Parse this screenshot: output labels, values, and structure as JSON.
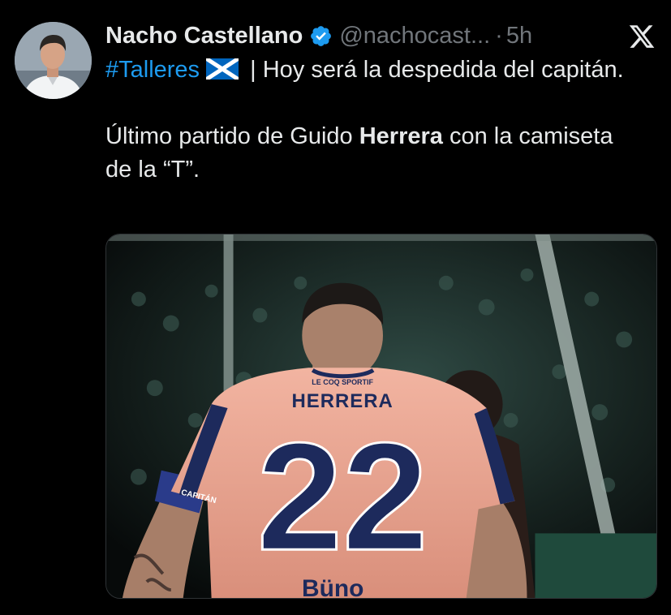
{
  "author": {
    "display_name": "Nacho Castellano",
    "handle": "@nachocast...",
    "separator": "·",
    "time": "5h",
    "verified": true,
    "avatar_icon": "user-avatar"
  },
  "tweet": {
    "hashtag": "#Talleres",
    "flag_icon": "scotland-flag-icon",
    "line1_rest": " | Hoy será la despedida del capitán.",
    "line2_start": "Último partido de Guido ",
    "line2_bold": "Herrera",
    "line2_end": " con la camiseta de la “T”."
  },
  "media": {
    "jersey_name": "HERRERA",
    "jersey_number": "22",
    "sponsor_text": "LE COQ SPORTIF",
    "armband_text": "CAPITÁN",
    "shirt_bottom_text": "Büno"
  },
  "colors": {
    "background": "#000000",
    "text": "#e7e9ea",
    "secondary": "#71767b",
    "link": "#1d9bf0",
    "verified": "#1d9bf0",
    "jersey": "#e8a491",
    "jersey_print": "#1d2a5c"
  },
  "icons": {
    "close": "x-logo-icon",
    "verified": "verified-badge-icon"
  }
}
